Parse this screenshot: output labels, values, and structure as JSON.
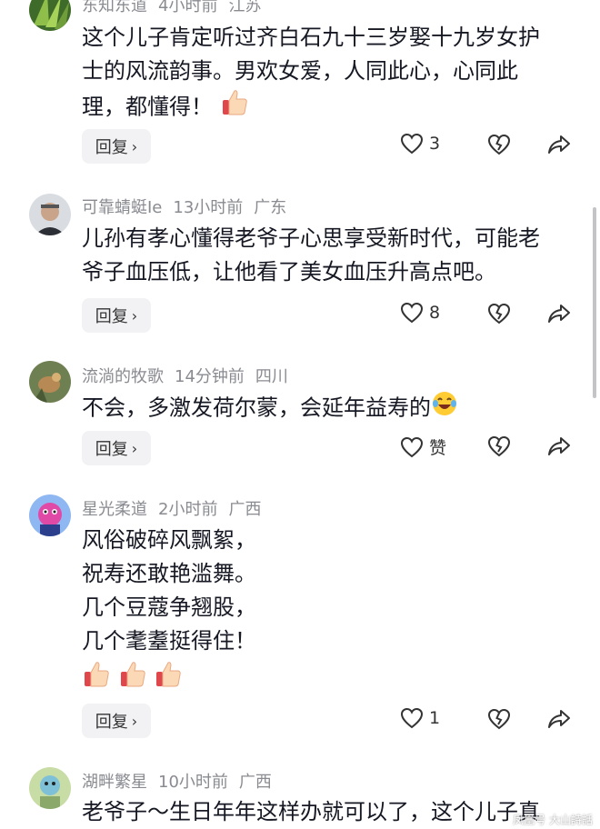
{
  "comments": [
    {
      "username": "东知东道",
      "time": "4小时前",
      "location": "江苏",
      "lines": [
        "这个儿子肯定听过齐白石九十三岁娶十九岁女护",
        "士的风流韵事。男欢女爱，人同此心，心同此",
        "理，都懂得！"
      ],
      "likes": "3"
    },
    {
      "username": "可靠蜻蜓Ie",
      "time": "13小时前",
      "location": "广东",
      "lines": [
        "儿孙有孝心懂得老爷子心思享受新时代，可能老",
        "爷子血压低，让他看了美女血压升高点吧。"
      ],
      "likes": "8"
    },
    {
      "username": "流淌的牧歌",
      "time": "14分钟前",
      "location": "四川",
      "lines": [
        "不会，多激发荷尔蒙，会延年益寿的"
      ],
      "likes": "赞"
    },
    {
      "username": "星光柔道",
      "time": "2小时前",
      "location": "广西",
      "lines": [
        "风俗破碎风飘絮，",
        "祝寿还敢艳滥舞。",
        "几个豆蔻争翘股，",
        "几个耄耋挺得住！"
      ],
      "likes": "1"
    },
    {
      "username": "湖畔繁星",
      "time": "10小时前",
      "location": "广西",
      "lines": [
        "老爷子～生日年年这样办就可以了，这个儿子真"
      ]
    }
  ],
  "reply_label": "回复",
  "watermark": "凤凰号 大山詩話",
  "icons": {
    "like": "heart-outline-icon",
    "dislike": "broken-heart-icon",
    "share": "share-arrow-icon",
    "thumbs_up": "thumbs-up-emoji",
    "laugh": "laughing-tears-emoji",
    "reply_chevron": "chevron-right-icon"
  }
}
